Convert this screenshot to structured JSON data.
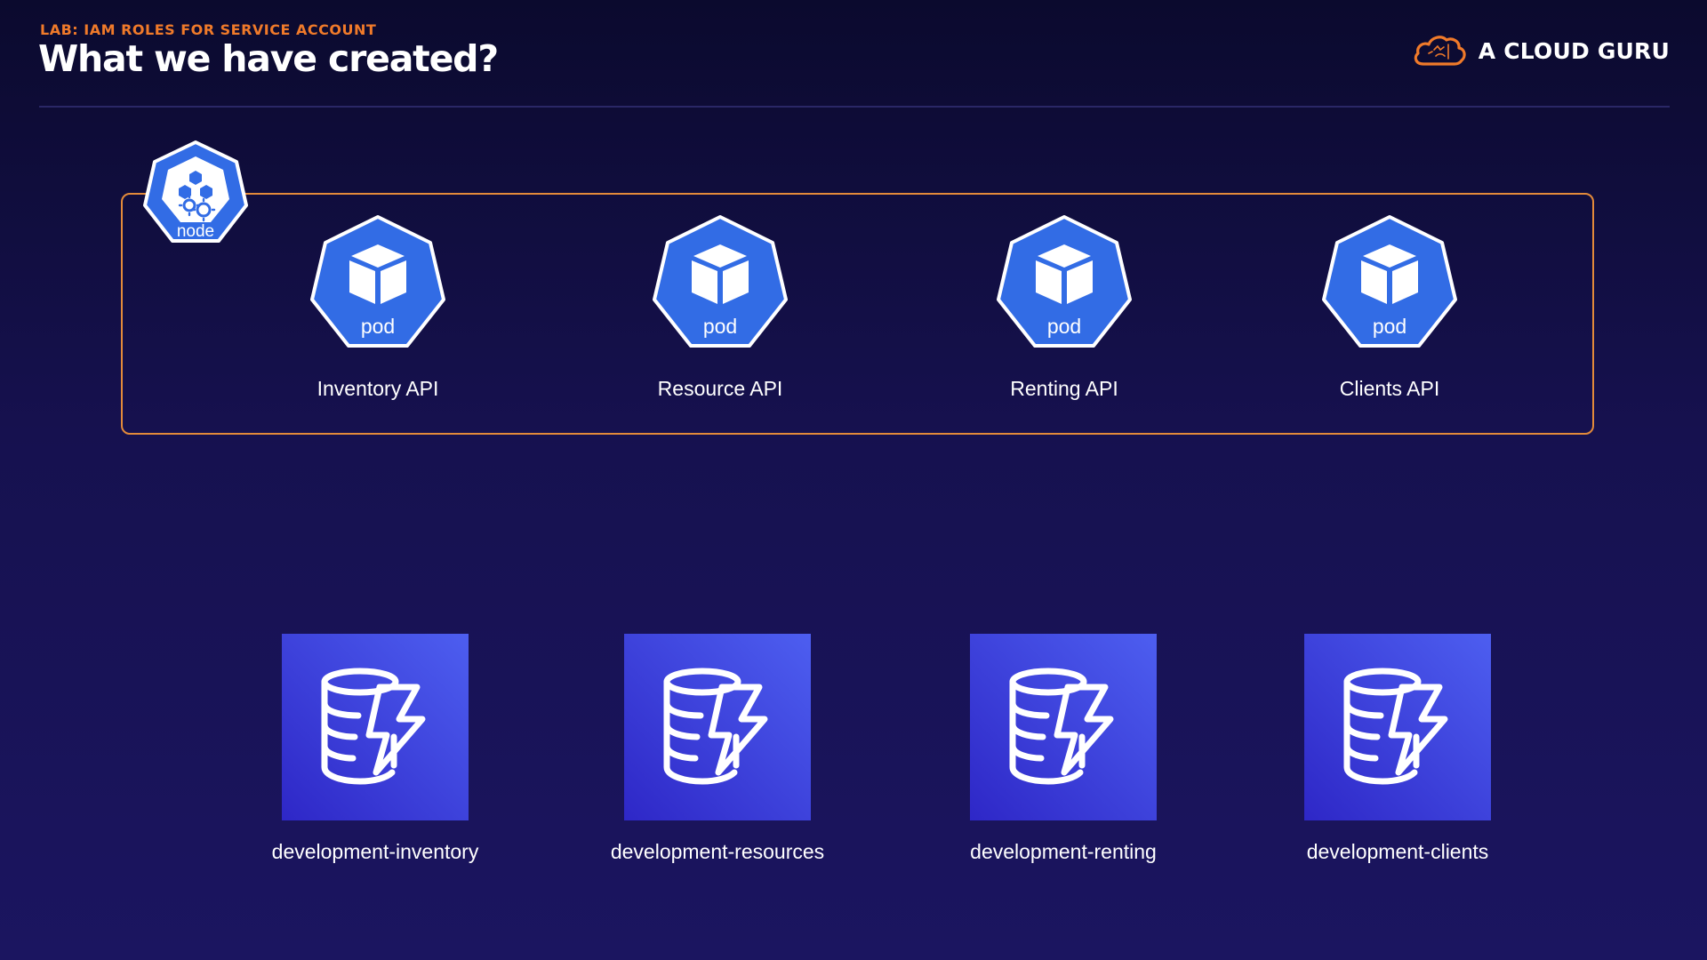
{
  "header": {
    "eyebrow": "LAB: IAM ROLES FOR SERVICE ACCOUNT",
    "title": "What we have created?",
    "brand": "A CLOUD GURU"
  },
  "node": {
    "label": "node",
    "icon": "kubernetes-node-icon"
  },
  "pods": [
    {
      "icon_label": "pod",
      "name": "Inventory API"
    },
    {
      "icon_label": "pod",
      "name": "Resource API"
    },
    {
      "icon_label": "pod",
      "name": "Renting API"
    },
    {
      "icon_label": "pod",
      "name": "Clients API"
    }
  ],
  "tables": [
    {
      "name": "development-inventory",
      "icon": "dynamodb-table-icon"
    },
    {
      "name": "development-resources",
      "icon": "dynamodb-table-icon"
    },
    {
      "name": "development-renting",
      "icon": "dynamodb-table-icon"
    },
    {
      "name": "development-clients",
      "icon": "dynamodb-table-icon"
    }
  ],
  "colors": {
    "background": "#15114a",
    "accent": "#f07a2a",
    "kubernetes_blue": "#326ce5",
    "dynamodb_blue": "#3b3fe0"
  }
}
